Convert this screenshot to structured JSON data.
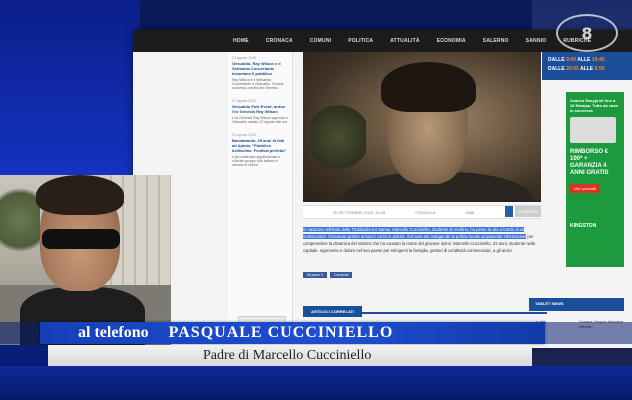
{
  "channel": {
    "logo_text": "8"
  },
  "website": {
    "nav_items": [
      "HOME",
      "CRONACA",
      "COMUNI",
      "POLITICA",
      "ATTUALITÀ",
      "ECONOMIA",
      "SALERNO",
      "SANNIO",
      "RUBRICHE"
    ],
    "weather": {
      "line1_prefix": "DALLE",
      "line1_time1": "9:00",
      "line1_mid": "ALLE",
      "line1_time2": "19:40",
      "line2_prefix": "DALLE",
      "line2_time1": "20:05",
      "line2_mid": "ALLE",
      "line2_time2": "6:50"
    },
    "sidebar": [
      {
        "date": "23 agosto 2015",
        "title": "Gesualdo, Ray Wilson e il Sethamia Concertante incantano il pubblico",
        "text": "Ray Wilson e il Sethamia Concertante a Gesualdo. Grande successo, serata dei Genesis"
      },
      {
        "date": "22 agosto 2015",
        "title": "Gesualdo Folk Event, arriva l'ex Genesis Ray Wilson",
        "text": "L'ex Genesis Ray Wilson approda a Gesualdo sabato 22 agosto alle ore"
      },
      {
        "date": "20 agosto 2015",
        "title": "Bandabardò, 25 anni di folk ad Irpinia: \"Pubblico bellissimo. Festival perfetto\"",
        "text": "Il più scatenato appassionato e colorato gruppo folk italiano è arrivato in Irpinia"
      }
    ],
    "sidebar_logo": "KidsWorld",
    "meta": {
      "date": "30 SETTEMBRE 2015, 10:28",
      "category": "CRONACA",
      "views": "1856",
      "more": "COMMENTA"
    },
    "article": {
      "highlighted": "In vacanza nell'isola della Thailandia Ko Samui, Marcello Cucciniello, studente di Avellino, ha perso la vita a bordo di un motoscooter. Chiamato gestire annunci conto in polizia. Sul caso sta indagando la polizia locale acquisendo informazioni",
      "normal": "per comprendere la dinamica del sinistro che ha causato la morte del giovane irpino. Marcello Cucciniello, 23 anni, studente nella capitale. Sgomento e dolore nel suo paese per stringersi la famiglia, gestori di un'attività commerciale, a gli amici."
    },
    "share_buttons": [
      "Mi piace 0",
      "Condividi"
    ],
    "related_label": "ARTICOLI CORRELATI",
    "ad": {
      "title": "Scarica Easyprint fino a 16 Stampa. Tutto da casa in sicurezza",
      "text": "Scansione Easyprint Fax Stampa. Tutto da casa in sicurezza",
      "big": "RIMBORSO € 100* + GARANZIA 4 ANNI GRATIS",
      "button": "Vai i prodotti",
      "brand": "KINGSTON"
    },
    "tablet_news": "TABLET NEWS",
    "news_date": "07",
    "news_text": "Cronaca Gregorio Marchese Ufficiale..."
  },
  "caption": {
    "label": "al telefono",
    "name": "PASQUALE CUCCINIELLO",
    "subtitle": "Padre di Marcello Cucciniello"
  }
}
